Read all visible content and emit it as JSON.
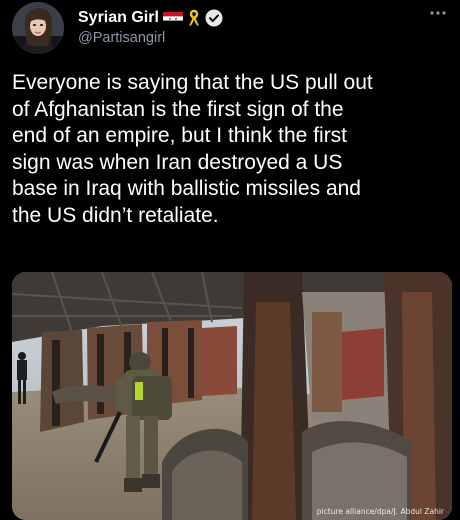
{
  "user": {
    "display_name": "Syrian Girl",
    "handle": "@Partisangirl",
    "badges": [
      "syria-flag-icon",
      "yellow-ribbon-icon",
      "verified-badge-icon"
    ]
  },
  "tweet": {
    "text": "Everyone is saying that the US pull out\nof Afghanistan is the first sign of the\nend of an empire, but I think the first\nsign was when Iran destroyed a US\nbase in Iraq with ballistic missiles and\nthe US didn’t retaliate."
  },
  "media": {
    "credit": "picture alliance/dpa/J. Abdul Zahir"
  },
  "colors": {
    "background": "#000000",
    "text": "#ffffff",
    "secondary_text": "#8b98a5",
    "verified": "#1d9bf0"
  }
}
